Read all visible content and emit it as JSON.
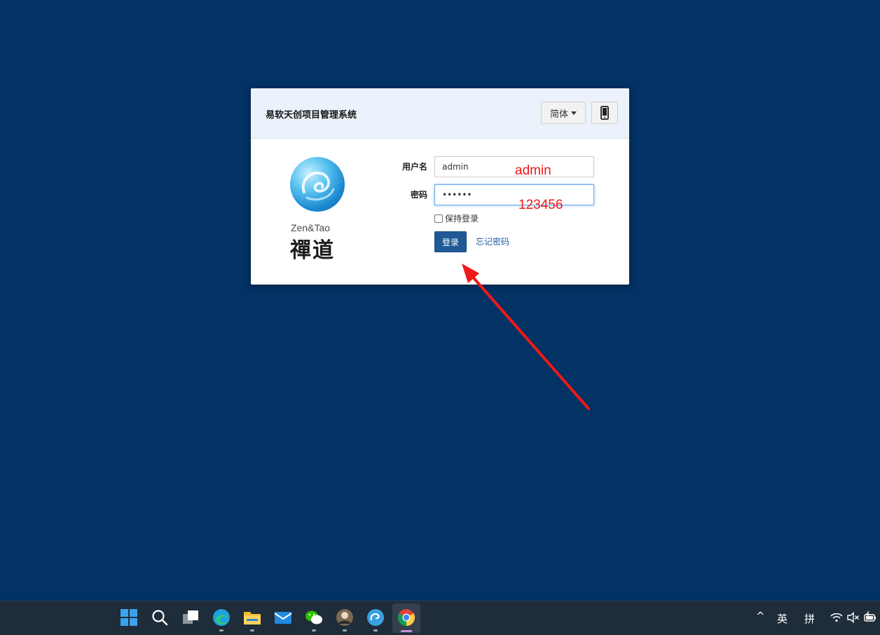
{
  "panel": {
    "title": "易软天创项目管理系统",
    "lang_label": "简体",
    "mobile_icon": "mobile-phone-icon"
  },
  "logo": {
    "icon": "zentao-logo-icon",
    "en_text": "Zen&Tao",
    "cn_text": "禪道"
  },
  "form": {
    "username_label": "用户名",
    "username_value": "admin",
    "password_label": "密码",
    "password_value": "••••••",
    "remember_label": "保持登录",
    "login_button": "登录",
    "forgot_link": "忘记密码"
  },
  "annotations": {
    "username_hint": "admin",
    "password_hint": "123456",
    "arrow_color": "#f01818"
  },
  "taskbar": {
    "icons": [
      "windows-start-icon",
      "search-icon",
      "task-view-icon",
      "edge-browser-icon",
      "file-explorer-icon",
      "mail-icon",
      "wechat-icon",
      "avatar-app-icon",
      "zentao-app-icon",
      "chrome-icon"
    ],
    "tray": {
      "chevron": "^",
      "ime_lang": "英",
      "ime_mode": "拼"
    }
  },
  "colors": {
    "background": "#033264",
    "header_bg": "#ebf2fb",
    "button_primary": "#1f5a96",
    "link": "#1f5fa8"
  }
}
